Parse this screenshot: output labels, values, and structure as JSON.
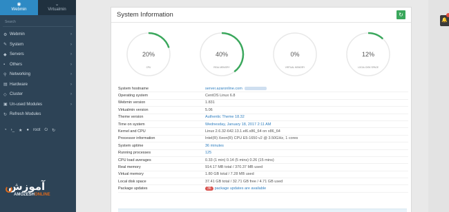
{
  "sidebar": {
    "tabs": [
      {
        "label": "Webmin",
        "icon": "webmin-icon"
      },
      {
        "label": "Virtualmin",
        "icon": "virtualmin-icon"
      }
    ],
    "search_placeholder": "Search",
    "items": [
      {
        "label": "Webmin",
        "icon": "gear-icon"
      },
      {
        "label": "System",
        "icon": "wrench-icon"
      },
      {
        "label": "Servers",
        "icon": "servers-icon"
      },
      {
        "label": "Others",
        "icon": "others-icon"
      },
      {
        "label": "Networking",
        "icon": "network-icon"
      },
      {
        "label": "Hardware",
        "icon": "hardware-icon"
      },
      {
        "label": "Cluster",
        "icon": "cluster-icon"
      },
      {
        "label": "Un-used Modules",
        "icon": "box-icon"
      },
      {
        "label": "Refresh Modules",
        "icon": "refresh-icon"
      }
    ],
    "user": "root"
  },
  "logo": {
    "fa": "آموزش",
    "en_pre": "AMOZESH",
    "en_post": "ONLINE"
  },
  "panel": {
    "title": "System Information",
    "gauges": [
      {
        "label": "CPU",
        "value": 20,
        "text": "20%"
      },
      {
        "label": "REAL MEMORY",
        "value": 40,
        "text": "40%"
      },
      {
        "label": "VIRTUAL MEMORY",
        "value": 0,
        "text": "0%"
      },
      {
        "label": "LOCAL DISK SPACE",
        "value": 12,
        "text": "12%"
      }
    ],
    "rows": [
      {
        "key": "System hostname",
        "value": "server.azaronline.com",
        "link": true,
        "blur": true
      },
      {
        "key": "Operating system",
        "value": "CentOS Linux 6.8"
      },
      {
        "key": "Webmin version",
        "value": "1.831"
      },
      {
        "key": "Virtualmin version",
        "value": "5.06"
      },
      {
        "key": "Theme version",
        "value": "Authentic Theme 18.32",
        "link": true
      },
      {
        "key": "Time on system",
        "value": "Wednesday, January 18, 2017 2:11 AM",
        "link": true
      },
      {
        "key": "Kernel and CPU",
        "value": "Linux 2.6.32-642.13.1.el6.x86_64 on x86_64"
      },
      {
        "key": "Processor information",
        "value": "Intel(R) Xeon(R) CPU E5-1650 v2 @ 3.50GHz, 1 cores"
      },
      {
        "key": "System uptime",
        "value": "36 minutes",
        "link": true
      },
      {
        "key": "Running processes",
        "value": "125",
        "link": true
      },
      {
        "key": "CPU load averages",
        "value": "0.33 (1 min) 0.14 (5 mins) 0.26 (15 mins)"
      },
      {
        "key": "Real memory",
        "value": "914.17 MB total / 370.37 MB used"
      },
      {
        "key": "Virtual memory",
        "value": "1.80 GB total / 7.28 MB used"
      },
      {
        "key": "Local disk space",
        "value": "37.41 GB total / 32.71 GB free / 4.71 GB used"
      },
      {
        "key": "Package updates",
        "value": "package updates are available",
        "badge": "36",
        "link": true
      }
    ]
  },
  "colors": {
    "sidebar": "#2d4356",
    "accent": "#2e8ac4",
    "gauge": "#3aa75c",
    "track": "#e8e8e8"
  }
}
